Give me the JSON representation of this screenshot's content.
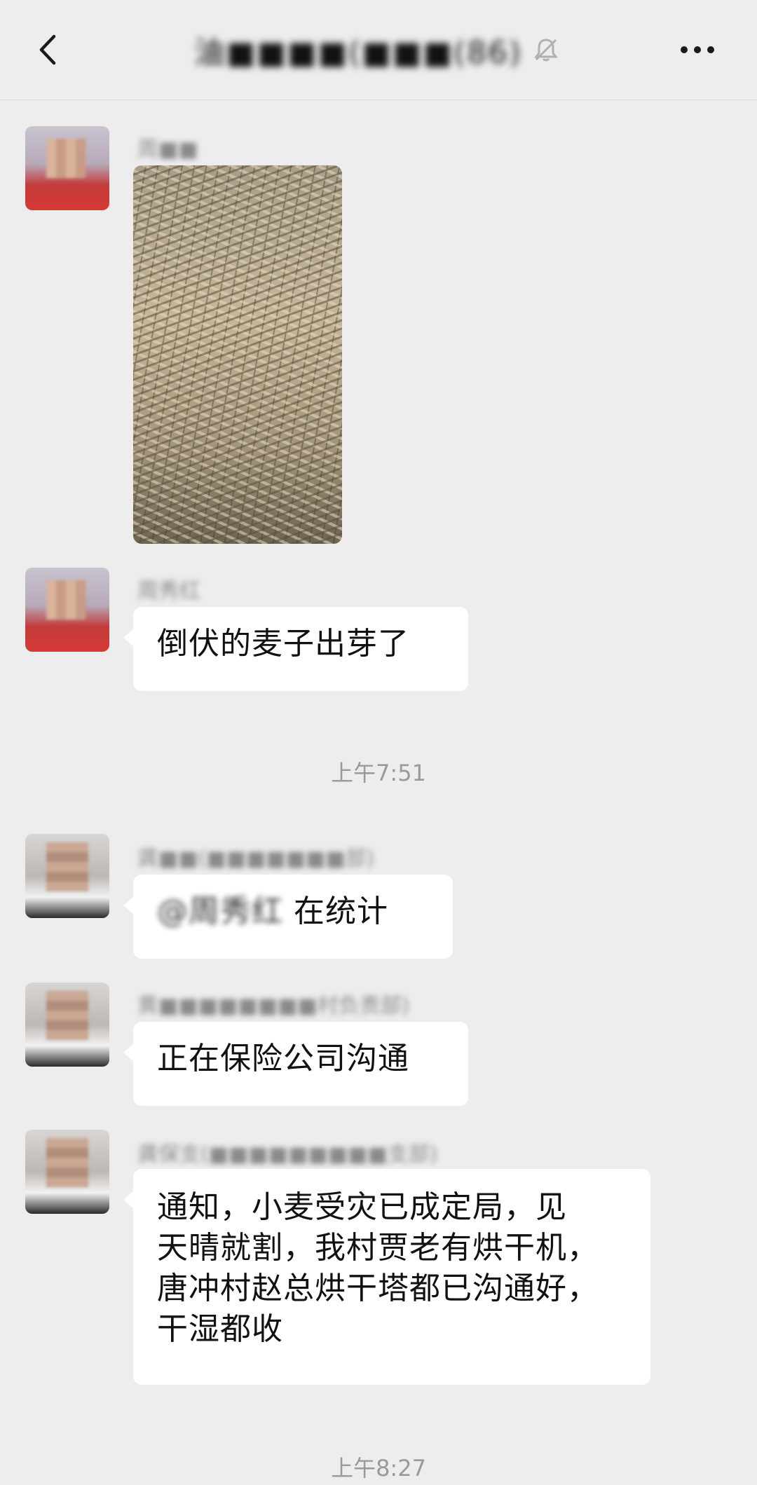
{
  "header": {
    "back_icon": "chevron-left-icon",
    "title": "油■■■■(■■■(86)",
    "mute_icon": "bell-off-icon",
    "more_icon": "more-horizontal-icon"
  },
  "messages": [
    {
      "sender": "周■■",
      "type": "image",
      "image_desc": "wheat-photo"
    },
    {
      "sender": "周秀红",
      "type": "text",
      "text": "倒伏的麦子出芽了"
    },
    {
      "timestamp": "上午7:51"
    },
    {
      "sender": "龚■■(■■■■■■■部)",
      "type": "text",
      "mention": "@周秀红",
      "text": "在统计"
    },
    {
      "sender": "黄■■■■■■■■村负责部)",
      "type": "text",
      "text": "正在保险公司沟通"
    },
    {
      "sender": "龚保支(■■■■■■■■■支部)",
      "type": "text",
      "lines": [
        "通知，小麦受灾已成定局，见",
        "天晴就割，我村贾老有烘干机，",
        "唐冲村赵总烘干塔都已沟通好，",
        "干湿都收"
      ]
    },
    {
      "timestamp": "上午8:27"
    }
  ]
}
